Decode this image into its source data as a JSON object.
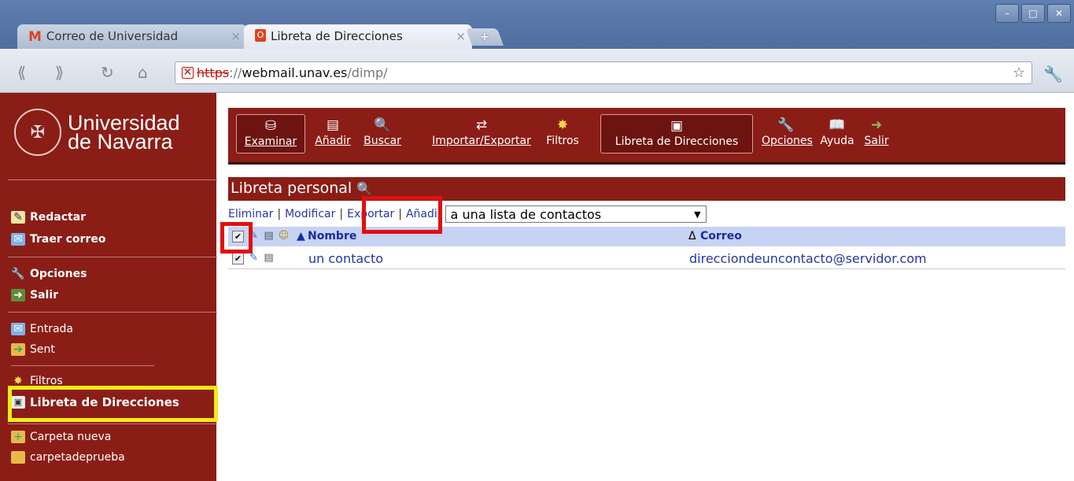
{
  "browser": {
    "tabs": [
      {
        "label": "Correo de Universidad",
        "icon": "gmail-icon",
        "close": "×"
      },
      {
        "label": "Libreta de Direcciones",
        "icon": "opera-icon",
        "close": "×"
      }
    ],
    "new_tab": "+",
    "window_buttons": [
      "–",
      "□",
      "✕"
    ],
    "url": {
      "scheme": "https",
      "rest": "://",
      "host": "webmail.unav.es",
      "path": "/dimp/"
    }
  },
  "sidebar": {
    "logo_line1": "Universidad",
    "logo_line2": "de Navarra",
    "items": [
      {
        "label": "Redactar",
        "icon": "compose-icon"
      },
      {
        "label": "Traer correo",
        "icon": "fetch-mail-icon"
      },
      {
        "label": "Opciones",
        "icon": "wrench-icon"
      },
      {
        "label": "Salir",
        "icon": "exit-door-icon"
      },
      {
        "label": "Entrada",
        "icon": "envelope-icon"
      },
      {
        "label": "Sent",
        "icon": "sent-folder-icon"
      },
      {
        "label": "Filtros",
        "icon": "wand-icon"
      },
      {
        "label": "Libreta de Direcciones",
        "icon": "address-book-icon"
      },
      {
        "label": "Carpeta nueva",
        "icon": "new-folder-icon"
      },
      {
        "label": "carpetadeprueba",
        "icon": "folder-icon"
      }
    ]
  },
  "menubar": {
    "items": [
      {
        "label": "Examinar",
        "icon": "browse-icon"
      },
      {
        "label": "Añadir",
        "icon": "add-contact-icon"
      },
      {
        "label": "Buscar",
        "icon": "magnifier-icon"
      },
      {
        "label": "Importar/Exportar",
        "icon": "import-export-icon"
      },
      {
        "label": "Filtros",
        "icon": "wand-icon"
      },
      {
        "label": "Libreta de Direcciones",
        "icon": "address-book-icon"
      },
      {
        "label": "Opciones",
        "icon": "wrench-icon"
      },
      {
        "label": "Ayuda",
        "icon": "book-icon"
      },
      {
        "label": "Salir",
        "icon": "exit-door-icon"
      }
    ]
  },
  "section": {
    "title": "Libreta personal"
  },
  "actions": {
    "delete": "Eliminar",
    "modify": "Modificar",
    "export": "Exportar",
    "add": "Añadir",
    "add_select": "a una lista de contactos"
  },
  "table": {
    "headers": {
      "name": "Nombre",
      "email": "Correo",
      "sort_asc": "▲",
      "sort_email": "Δ"
    },
    "rows": [
      {
        "name": "un contacto",
        "email": "direcciondeuncontacto@servidor.com",
        "checked": "☑"
      }
    ]
  },
  "colors": {
    "brand": "#8b1d17",
    "link": "#2536a5",
    "header_bg": "#c6d3f3",
    "annotation_red": "#e01010",
    "annotation_yellow": "#f2ea18"
  }
}
